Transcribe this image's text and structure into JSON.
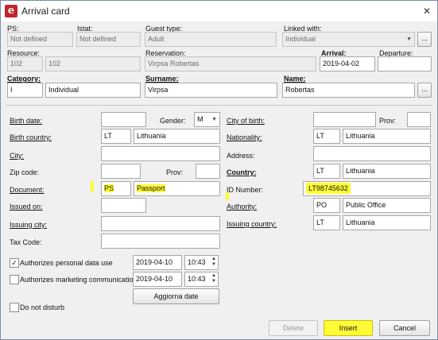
{
  "window": {
    "title": "Arrival card",
    "close": "✕",
    "app_letter": "e"
  },
  "header": {
    "ps_label": "PS:",
    "ps_value": "Not defined",
    "istat_label": "Istat:",
    "istat_value": "Not defined",
    "guest_type_label": "Guest type:",
    "guest_type_value": "Adult",
    "linked_with_label": "Linked with:",
    "linked_with_value": "Individual",
    "linked_with_button": "...",
    "resource_label": "Resource:",
    "resource_code": "102",
    "resource_value": "102",
    "reservation_label": "Reservation:",
    "reservation_value": "Virpsa Robertas",
    "arrival_label": "Arrival:",
    "arrival_value": "2019-04-02",
    "departure_label": "Departure:",
    "departure_value": "",
    "category_label": "Category:",
    "category_code": "I",
    "category_value": "Individual",
    "surname_label": "Surname:",
    "surname_value": "Virpsa",
    "name_label": "Name:",
    "name_value": "Robertas",
    "name_button": "..."
  },
  "left": {
    "birth_date_label": "Birth date:",
    "birth_date_value": "",
    "gender_label": "Gender:",
    "gender_value": "M",
    "birth_country_label": "Birth country:",
    "birth_country_code": "LT",
    "birth_country_value": "Lithuania",
    "city_label": "City:",
    "city_value": "",
    "zip_label": "Zip code:",
    "zip_value": "",
    "prov_label": "Prov:",
    "prov_value": "",
    "document_label": "Document:",
    "document_code": "PS",
    "document_value": "Passport",
    "issued_on_label": "Issued on:",
    "issued_on_value": "",
    "issuing_city_label": "Issuing city:",
    "issuing_city_value": "",
    "tax_code_label": "Tax Code:",
    "tax_code_value": "",
    "personal_data_label": "Authorizes personal data use",
    "personal_data_checked": "✓",
    "personal_date": "2019-04-10",
    "personal_time": "10:43",
    "marketing_label": "Authorizes marketing communications",
    "marketing_date": "2019-04-10",
    "marketing_time": "10:43",
    "update_dates_button": "Aggiorna date",
    "do_not_disturb_label": "Do not disturb"
  },
  "right": {
    "city_of_birth_label": "City of birth:",
    "city_of_birth_value": "",
    "prov_label": "Prov:",
    "prov_value": "",
    "nationality_label": "Nationality:",
    "nationality_code": "LT",
    "nationality_value": "Lithuania",
    "address_label": "Address:",
    "address_value": "",
    "country_label": "Country:",
    "country_code": "LT",
    "country_value": "Lithuania",
    "id_number_label": "ID Number:",
    "id_number_value": "LT98745632",
    "authority_label": "Authority:",
    "authority_code": "PO",
    "authority_value": "Public Office",
    "issuing_country_label": "Issuing country:",
    "issuing_country_code": "LT",
    "issuing_country_value": "Lithuania"
  },
  "footer": {
    "delete_button": "Delete",
    "insert_button": "Insert",
    "cancel_button": "Cancel"
  },
  "colors": {
    "highlight": "#fffb37",
    "app_icon": "#c0272d",
    "separator": "#bcc6d4"
  }
}
